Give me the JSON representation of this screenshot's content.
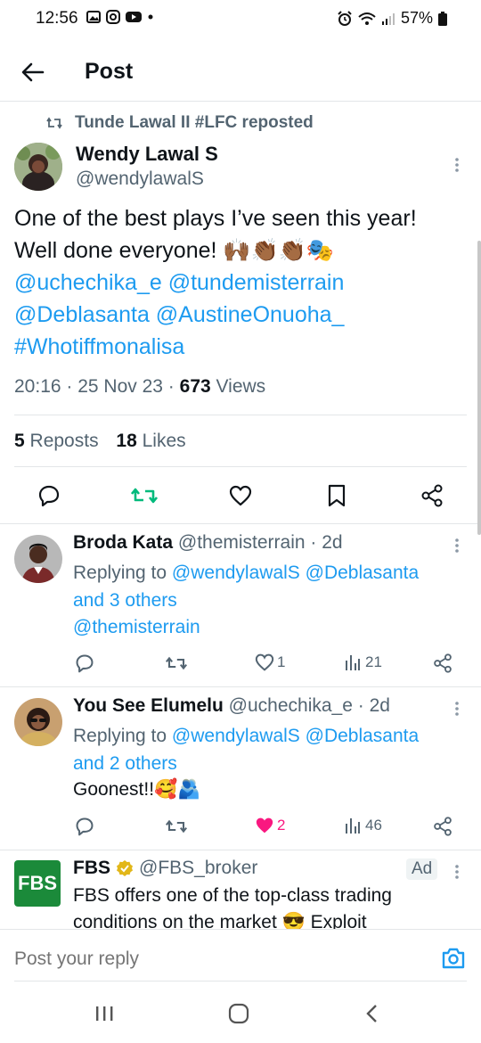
{
  "status_bar": {
    "time": "12:56",
    "battery": "57%"
  },
  "header": {
    "title": "Post",
    "back_icon": "arrow-left-icon"
  },
  "post": {
    "reposted_by": "Tunde Lawal II #LFC reposted",
    "author_name": "Wendy Lawal S",
    "author_handle": "@wendylawalS",
    "text_line1": "One of the best plays I’ve seen this year!",
    "text_line2": "Well done everyone!",
    "emojis": "🙌🏾👏🏾👏🏾🎭",
    "mention_line1": "@uchechika_e @tundemisterrain",
    "mention_line2": "@Deblasanta @AustineOnuoha_",
    "hashtag": "#Whotiffmonalisa",
    "time": "20:16",
    "date": "25 Nov 23",
    "views_count": "673",
    "views_label": "Views",
    "reposts_count": "5",
    "reposts_label": "Reposts",
    "likes_count": "18",
    "likes_label": "Likes"
  },
  "replies": [
    {
      "name": "Broda Kata",
      "handle": "@themisterrain",
      "age": "2d",
      "replying_prefix": "Replying to",
      "replying_to": "@wendylawalS @Deblasanta",
      "replying_more": "and 3 others",
      "body": "@themisterrain",
      "likes": "1",
      "views": "21"
    },
    {
      "name": "You See Elumelu",
      "handle": "@uchechika_e",
      "age": "2d",
      "replying_prefix": "Replying to",
      "replying_to": "@wendylawalS @Deblasanta",
      "replying_more": "and 2 others",
      "body": "Goonest!!",
      "body_emoji": "🥰🫂",
      "likes": "2",
      "views": "46"
    }
  ],
  "ad": {
    "logo_text": "FBS",
    "name": "FBS",
    "handle": "@FBS_broker",
    "badge": "Ad",
    "line1": "FBS offers one of the top-class trading",
    "line2": "conditions on the market 😎 Exploit"
  },
  "reply_box": {
    "placeholder": "Post your reply"
  },
  "colors": {
    "accent": "#1d9bf0",
    "repost_green": "#00ba7c",
    "like_pink": "#f91880",
    "text_secondary": "#536471"
  }
}
